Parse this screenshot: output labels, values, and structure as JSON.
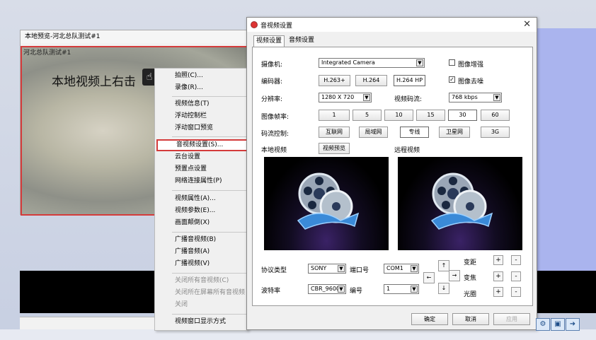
{
  "preview": {
    "window_title": "本地预览-河北总队测试#1",
    "channel_label": "河北总队测试#1",
    "overlay_text": "本地视频上右击"
  },
  "context_menu": {
    "items": [
      {
        "label": "拍照(C)..."
      },
      {
        "label": "录像(R)..."
      },
      {
        "label": "视频信息(T)"
      },
      {
        "label": "浮动控制栏"
      },
      {
        "label": "浮动窗口预览"
      },
      {
        "label": "音视频设置(S)..."
      },
      {
        "label": "云台设置"
      },
      {
        "label": "预置点设置"
      },
      {
        "label": "网络连接属性(P)"
      },
      {
        "label": "视频属性(A)..."
      },
      {
        "label": "视频参数(E)..."
      },
      {
        "label": "画面颠倒(X)"
      },
      {
        "label": "广播音视频(B)"
      },
      {
        "label": "广播音频(A)"
      },
      {
        "label": "广播视频(V)"
      },
      {
        "label": "关闭所有音视频(C)"
      },
      {
        "label": "关闭所在屏幕所有音视频"
      },
      {
        "label": "关闭"
      },
      {
        "label": "视频窗口显示方式"
      }
    ]
  },
  "dialog": {
    "title": "音视频设置",
    "close_glyph": "✕",
    "tabs": [
      {
        "label": "视频设置"
      },
      {
        "label": "音频设置"
      }
    ],
    "camera": {
      "label": "摄像机:",
      "value": "Integrated Camera",
      "enhance_label": "图像增强",
      "enhance_checked": false
    },
    "codec": {
      "label": "编码器:",
      "options": [
        "H.263+",
        "H.264",
        "H.264 HP"
      ],
      "selected": "H.264 HP",
      "denoise_label": "图像去噪",
      "denoise_checked": true
    },
    "resolution": {
      "label": "分辨率:",
      "value": "1280 X 720",
      "bitrate_label": "视频码流:",
      "bitrate_value": "768  kbps"
    },
    "framerate": {
      "label": "图像帧率:",
      "options": [
        "1",
        "5",
        "10",
        "15",
        "30",
        "60"
      ],
      "selected": "30"
    },
    "stream_control": {
      "label": "码流控制:",
      "options": [
        "互联网",
        "局域网",
        "专线",
        "卫星网",
        "3G"
      ],
      "selected": "专线"
    },
    "local_video": {
      "label": "本地视频",
      "preview_button": "视频预览"
    },
    "remote_video": {
      "label": "远程视频"
    },
    "protocol": {
      "label": "协议类型",
      "value": "SONY",
      "port_label": "端口号",
      "port_value": "COM1"
    },
    "baud": {
      "label": "波特率",
      "value": "CBR_9600",
      "number_label": "编号",
      "number_value": "1"
    },
    "ptz": {
      "zoom_label": "变距",
      "focus_label": "变焦",
      "iris_label": "光圈",
      "plus": "+",
      "minus": "-",
      "up": "↑",
      "down": "↓",
      "left": "←",
      "right": "→"
    },
    "footer": {
      "ok": "确定",
      "cancel": "取消",
      "apply": "应用"
    }
  },
  "colors": {
    "highlight_red": "#d43b3b",
    "menu_bg": "#f0f0f0"
  }
}
